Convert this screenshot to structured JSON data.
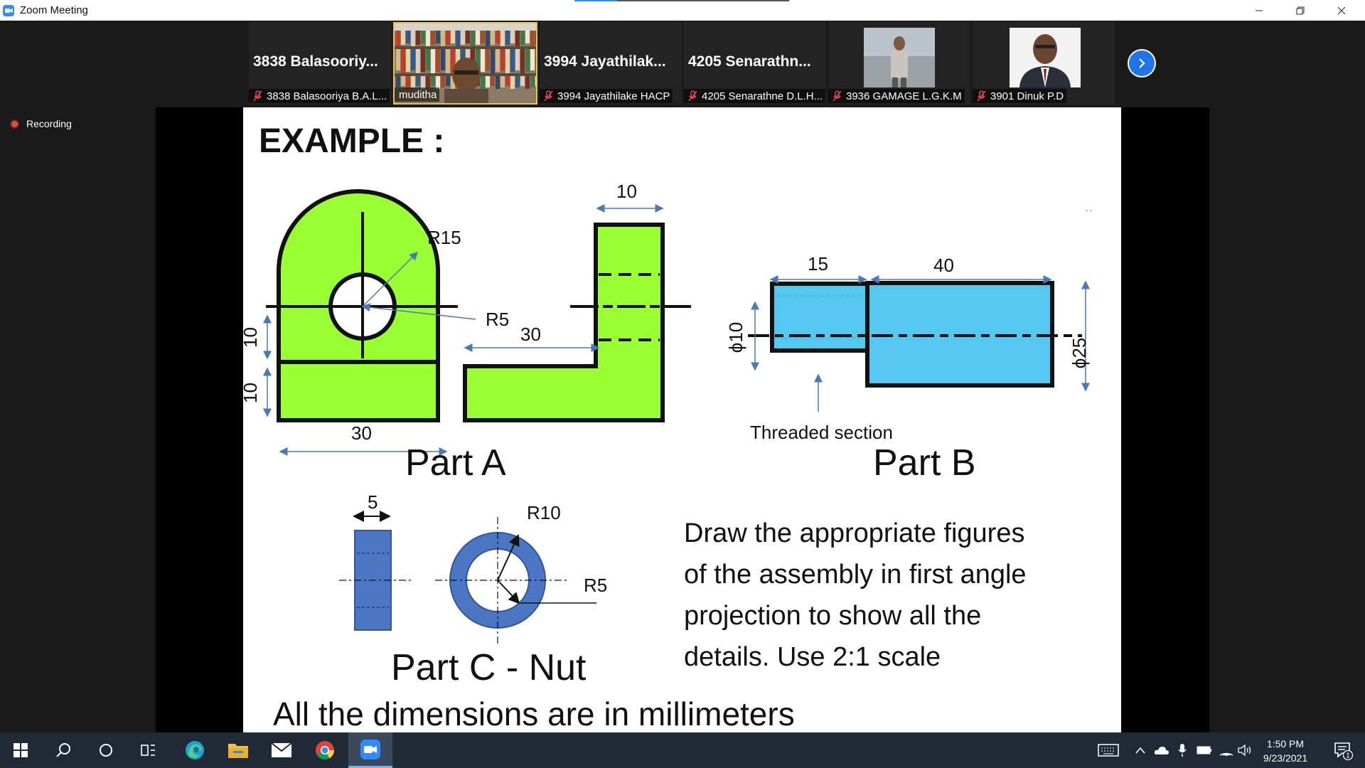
{
  "window": {
    "title": "Zoom Meeting",
    "share_progress": 0.2
  },
  "participants": [
    {
      "big_name": "3838  Balasooriy...",
      "label": "3838 Balasooriya B.A.L...",
      "muted": true
    },
    {
      "big_name": "",
      "label": "muditha",
      "muted": false,
      "video": true
    },
    {
      "big_name": "3994  Jayathilak...",
      "label": "3994 Jayathilake HACP",
      "muted": true
    },
    {
      "big_name": "4205  Senarathn...",
      "label": "4205 Senarathne D.L.H...",
      "muted": true
    },
    {
      "big_name": "",
      "label": "3936 GAMAGE L.G.K.M",
      "muted": true,
      "photo": true
    },
    {
      "big_name": "",
      "label": "3901 Dinuk P.D",
      "muted": true,
      "photo": true
    }
  ],
  "recording": {
    "label": "Recording"
  },
  "slide": {
    "heading": "EXAMPLE :",
    "part_a": {
      "caption": "Part A",
      "dims": {
        "r15": "R15",
        "r5": "R5",
        "d10_top": "10",
        "d30_mid": "30",
        "d10_left1": "10",
        "d10_left2": "10",
        "d30_bottom": "30"
      }
    },
    "part_b": {
      "caption": "Part B",
      "dims": {
        "d15": "15",
        "d40": "40",
        "phi10": "ϕ10",
        "phi25": "ϕ25"
      },
      "threaded_label": "Threaded section"
    },
    "part_c": {
      "caption": "Part C - Nut",
      "dims": {
        "d5": "5",
        "r10": "R10",
        "r5": "R5"
      }
    },
    "instruction": [
      "Draw the appropriate figures",
      "of the assembly in first angle",
      "projection to show all the",
      "details. Use 2:1 scale"
    ],
    "footer": "All the dimensions are in millimeters",
    "colors": {
      "part_a": "#99ff33",
      "part_b": "#55c8f2",
      "part_c": "#4a76c4"
    }
  },
  "taskbar": {
    "time": "1:50 PM",
    "date": "9/23/2021",
    "notification_count": "1",
    "apps": [
      "windows-start",
      "search",
      "cortana",
      "task-view",
      "edge",
      "file-explorer",
      "mail",
      "chrome",
      "zoom"
    ]
  }
}
